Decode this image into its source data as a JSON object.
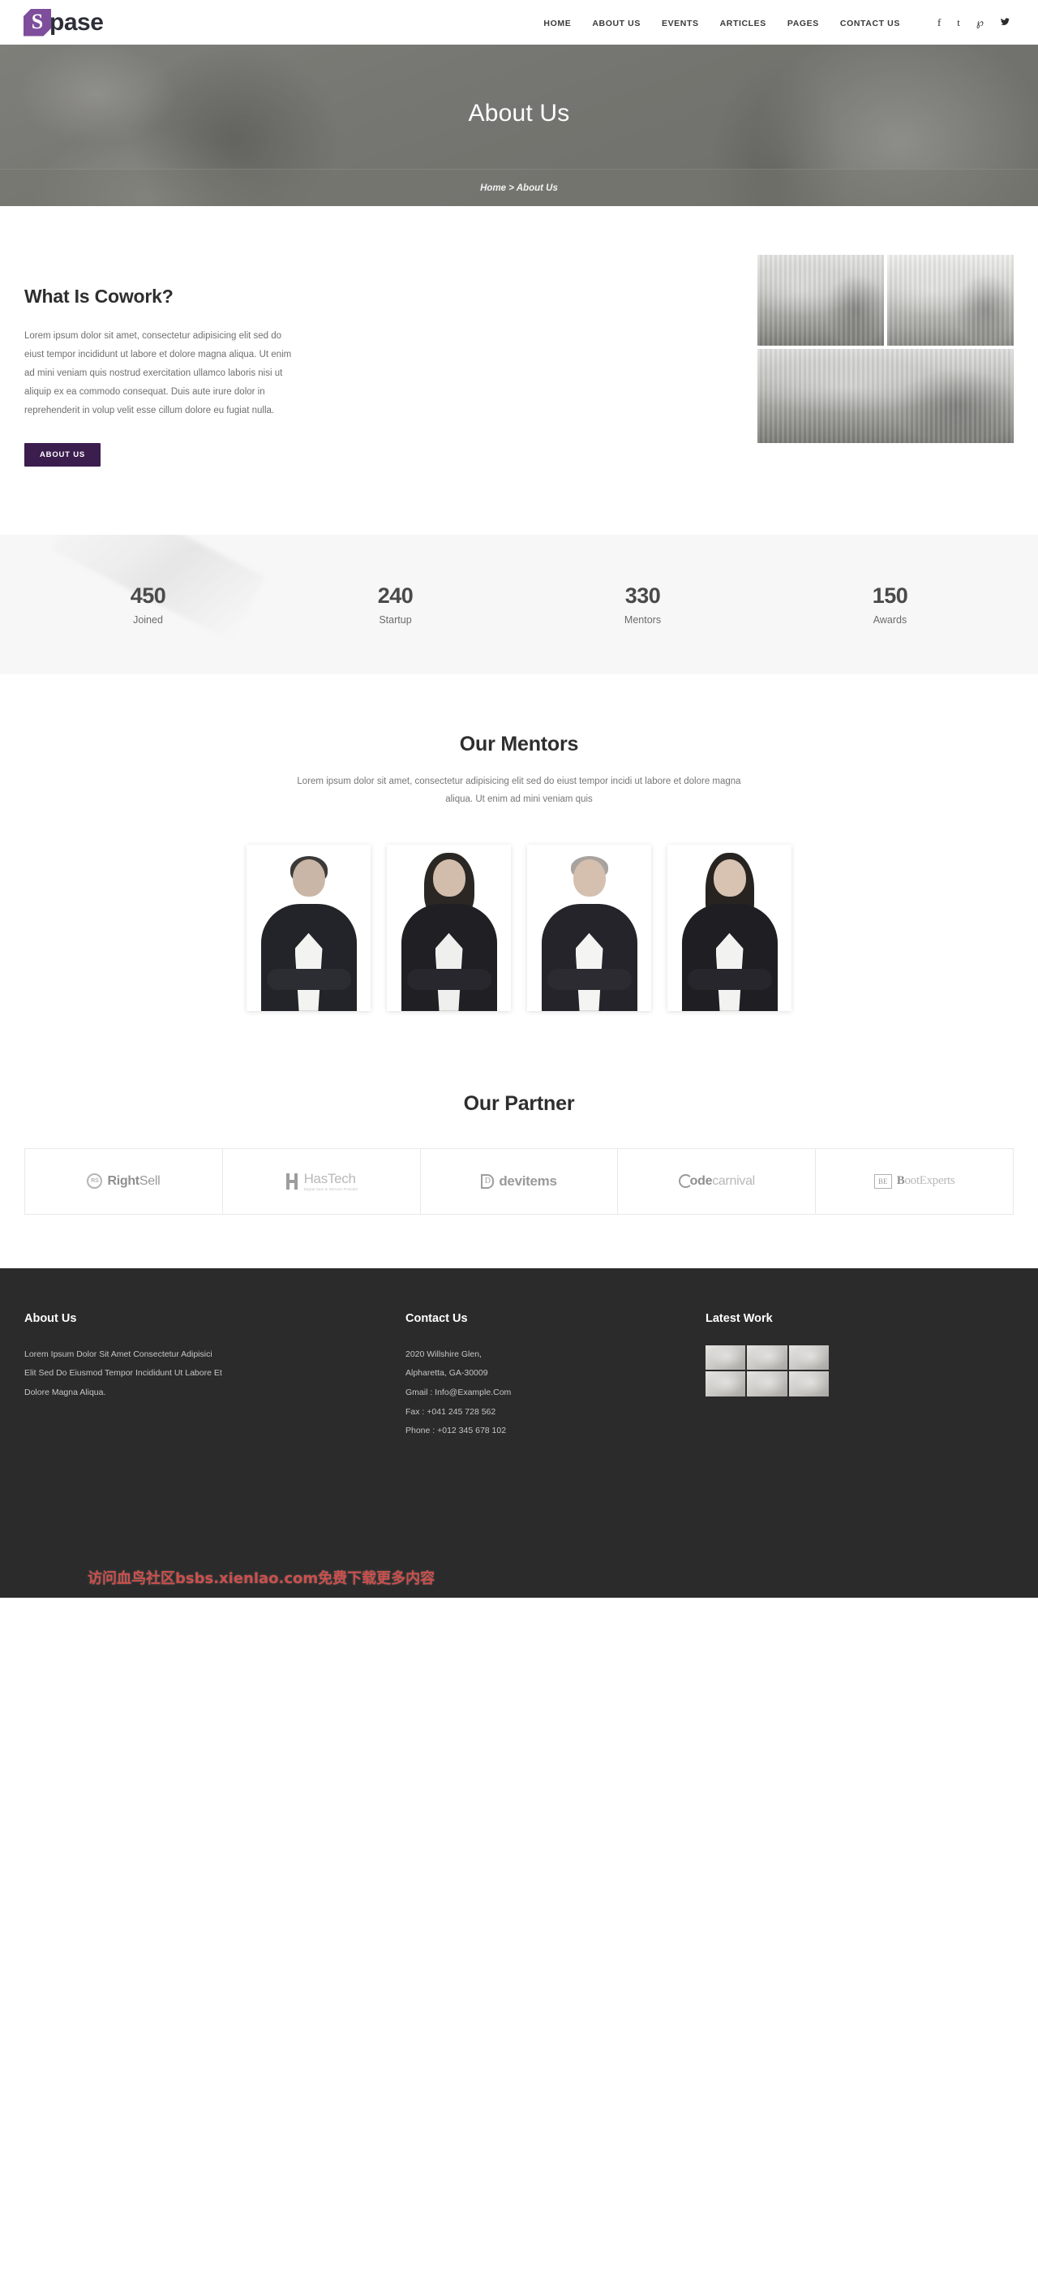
{
  "header": {
    "logo_mark": "S",
    "logo_text": "pase",
    "nav": [
      {
        "label": "HOME"
      },
      {
        "label": "ABOUT US"
      },
      {
        "label": "EVENTS"
      },
      {
        "label": "ARTICLES"
      },
      {
        "label": "PAGES"
      },
      {
        "label": "CONTACT US"
      }
    ],
    "socials": [
      {
        "name": "facebook-icon",
        "glyph": "f"
      },
      {
        "name": "tumblr-icon",
        "glyph": "t"
      },
      {
        "name": "pinterest-icon",
        "glyph": "℘"
      },
      {
        "name": "twitter-icon",
        "glyph": "🐦"
      }
    ]
  },
  "hero": {
    "title": "About Us",
    "breadcrumb": "Home > About Us",
    "breadcrumb_home": "Home",
    "breadcrumb_sep": ">",
    "breadcrumb_current": "About Us"
  },
  "cowork": {
    "title": "What Is Cowork?",
    "body": "Lorem ipsum dolor sit amet, consectetur adipisicing elit sed do eiust tempor incididunt ut labore et dolore magna aliqua. Ut enim ad mini veniam quis nostrud exercitation ullamco laboris nisi ut aliquip ex ea commodo consequat. Duis aute irure dolor in reprehenderit in volup velit esse cillum dolore eu fugiat nulla.",
    "button_label": "ABOUT US",
    "gallery": [
      {
        "alt": "office-cubicles-photo"
      },
      {
        "alt": "open-office-desks-photo"
      },
      {
        "alt": "coworking-lounge-photo"
      }
    ]
  },
  "counters": [
    {
      "number": "450",
      "label": "Joined"
    },
    {
      "number": "240",
      "label": "Startup"
    },
    {
      "number": "330",
      "label": "Mentors"
    },
    {
      "number": "150",
      "label": "Awards"
    }
  ],
  "mentors": {
    "title": "Our Mentors",
    "subtitle": "Lorem ipsum dolor sit amet, consectetur adipisicing elit sed do eiust tempor incidi ut labore et dolore magna aliqua. Ut enim ad mini veniam quis",
    "people": [
      {
        "alt": "mentor-photo-1"
      },
      {
        "alt": "mentor-photo-2"
      },
      {
        "alt": "mentor-photo-3"
      },
      {
        "alt": "mentor-photo-4"
      }
    ]
  },
  "partners": {
    "title": "Our Partner",
    "logos": [
      {
        "mark": "RS",
        "name_bold": "Right",
        "name_light": "Sell",
        "tagline": ""
      },
      {
        "mark": "H",
        "name_bold": "Has",
        "name_light": "Tech",
        "tagline": "Digital Item & Service Provider"
      },
      {
        "mark": "D",
        "name_bold": "",
        "name_light": "devitems",
        "tagline": ""
      },
      {
        "mark": "C",
        "name_bold": "ode",
        "name_light": "carnival",
        "tagline": ""
      },
      {
        "mark": "BE",
        "name_bold": "B",
        "name_light": "ootExperts",
        "tagline": ""
      }
    ]
  },
  "footer": {
    "about": {
      "title": "About Us",
      "lines": [
        "Lorem Ipsum Dolor Sit Amet Consectetur Adipisici",
        "Elit Sed Do Eiusmod Tempor Incididunt Ut Labore Et",
        "Dolore Magna Aliqua."
      ]
    },
    "contact": {
      "title": "Contact Us",
      "lines": [
        "2020 Willshire Glen,",
        "Alpharetta, GA-30009",
        "Gmail : Info@Example.Com",
        "Fax : +041 245 728 562",
        "Phone : +012 345 678 102"
      ]
    },
    "work": {
      "title": "Latest Work",
      "thumbs": [
        {
          "alt": "work-thumb-1"
        },
        {
          "alt": "work-thumb-2"
        },
        {
          "alt": "work-thumb-3"
        },
        {
          "alt": "work-thumb-4"
        },
        {
          "alt": "work-thumb-5"
        },
        {
          "alt": "work-thumb-6"
        }
      ]
    },
    "watermark": "访问血鸟社区bsbs.xienlao.com免费下载更多内容"
  },
  "colors": {
    "brand_purple": "#7e4e9c",
    "button_purple": "#3b1d4e",
    "footer_bg": "#2b2b2b",
    "counter_bg": "#f7f7f7",
    "watermark_red": "#d9534f"
  }
}
